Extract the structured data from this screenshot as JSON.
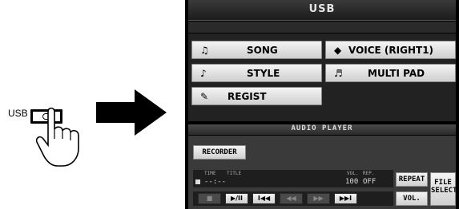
{
  "illustration": {
    "usb_label": "USB"
  },
  "screen": {
    "title": "USB",
    "menu": {
      "song": "SONG",
      "voice": "VOICE (RIGHT1)",
      "style": "STYLE",
      "multipad": "MULTI PAD",
      "regist": "REGIST"
    },
    "audio_player": {
      "section_title": "AUDIO PLAYER",
      "recorder": "RECORDER",
      "headers": {
        "time": "TIME",
        "title": "TITLE",
        "vol": "VOL.",
        "rep": "REP."
      },
      "values": {
        "time": "--:--",
        "vol": "100",
        "rep": "OFF"
      },
      "repeat": "REPEAT",
      "vol_button": "VOL.",
      "file_select_1": "FILE",
      "file_select_2": "SELECT",
      "transport": {
        "stop": "■",
        "play_pause": "▶/II",
        "prev": "I◀◀",
        "rew": "◀◀",
        "ff": "▶▶",
        "next": "▶▶I"
      }
    }
  }
}
